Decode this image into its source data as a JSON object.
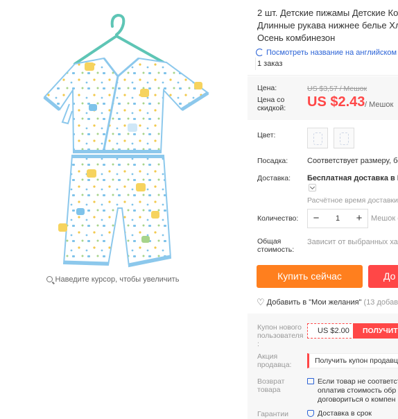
{
  "product": {
    "title_lines": [
      "2 шт. Детские пижамы Детские Ко",
      "Длинные рукава нижнее белье Хл",
      "Осень комбинезон"
    ],
    "translate_link": "Посмотреть название на английском",
    "orders": "1 заказ"
  },
  "gallery": {
    "zoom_hint": "Наведите курсор, чтобы увеличить"
  },
  "price": {
    "label": "Цена:",
    "old": "US $3,57 / Мешок",
    "discount_label": "Цена со скидкой:",
    "new": "US $2.43",
    "unit": "/ Мешок"
  },
  "options": {
    "color_label": "Цвет:",
    "fit_label": "Посадка:",
    "fit_value": "Соответствует размеру, бер",
    "shipping_label": "Доставка:",
    "shipping_value": "Бесплатная доставка в Ru",
    "delivery_estimate": "Расчётное время доставки",
    "qty_label": "Количество:",
    "qty_minus": "−",
    "qty_value": "1",
    "qty_plus": "+",
    "qty_note": "Мешок о",
    "total_label": "Общая стоимость:",
    "total_value": "Зависит от выбранных хар"
  },
  "actions": {
    "buy_now": "Купить сейчас",
    "add_to_cart": "До",
    "wishlist": "Добавить в \"Мои желания\"",
    "wishlist_count": "(13 добав"
  },
  "extras": {
    "new_user_coupon_label": "Купон нового пользователя :",
    "coupon_amount": "US $2.00",
    "coupon_button": "ПОЛУЧИТЬ",
    "seller_promo_label": "Акция продавца:",
    "seller_promo_value": "Получить купон продавц",
    "return_label": "Возврат товара",
    "return_line1": "Если товар не соответст",
    "return_line2": "оплатив стоимость обр",
    "return_line3": "договориться о компен",
    "guarantee_label": "Гарантии",
    "guarantee_value": "Доставка в срок"
  },
  "colors": {
    "price_red": "#ff4747",
    "buy_orange": "#ff7f1e",
    "link_blue": "#2a62d6",
    "hanger_teal": "#5ec5b5",
    "garment_trim": "#8cc8ec"
  }
}
